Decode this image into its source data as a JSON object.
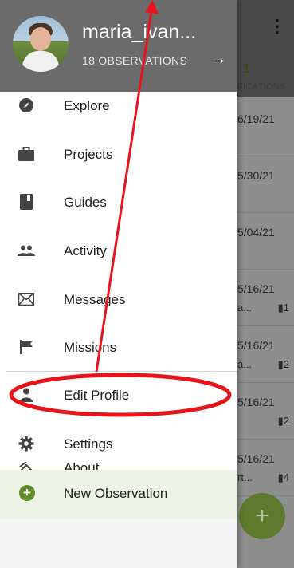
{
  "background": {
    "count": "1",
    "column_label": "FICATIONS",
    "rows": [
      {
        "date": "6/19/21",
        "sub": "",
        "badge": ""
      },
      {
        "date": "5/30/21",
        "sub": "",
        "badge": ""
      },
      {
        "date": "5/04/21",
        "sub": "",
        "badge": ""
      },
      {
        "date": "5/16/21",
        "sub": "a...",
        "badge": "1"
      },
      {
        "date": "5/16/21",
        "sub": "a...",
        "badge": "2"
      },
      {
        "date": "5/16/21",
        "sub": "",
        "badge": "2"
      },
      {
        "date": "5/16/21",
        "sub": "rt...",
        "badge": "4"
      }
    ],
    "fab_label": "+"
  },
  "drawer": {
    "username": "maria_ivan...",
    "observations": "18 OBSERVATIONS",
    "items": [
      {
        "label": "Explore",
        "icon": "compass-icon"
      },
      {
        "label": "Projects",
        "icon": "briefcase-icon"
      },
      {
        "label": "Guides",
        "icon": "book-icon"
      },
      {
        "label": "Activity",
        "icon": "people-icon"
      },
      {
        "label": "Messages",
        "icon": "envelope-icon"
      },
      {
        "label": "Missions",
        "icon": "flag-icon"
      },
      {
        "label": "Edit Profile",
        "icon": "person-icon"
      },
      {
        "label": "Settings",
        "icon": "gear-icon"
      },
      {
        "label": "About",
        "icon": "about-icon"
      }
    ],
    "new_observation": "New Observation"
  },
  "colors": {
    "annotation": "#e8141b",
    "accent_green": "#5f8b2a"
  }
}
